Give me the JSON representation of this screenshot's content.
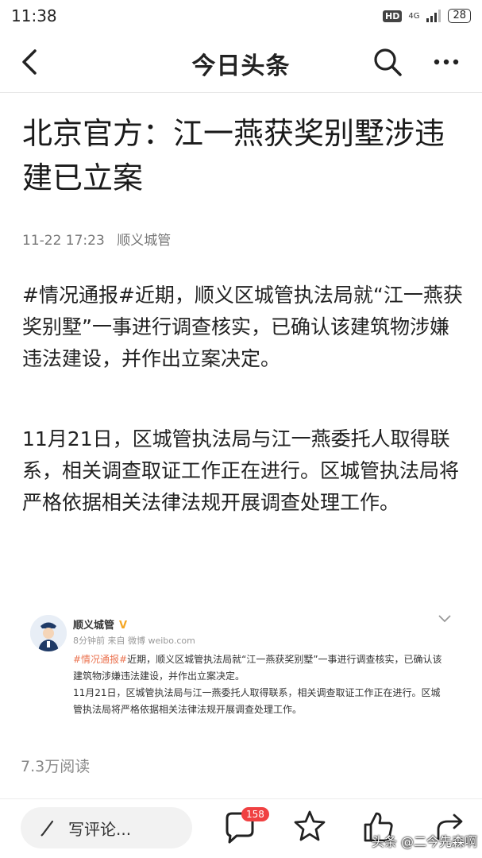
{
  "status": {
    "time": "11:38",
    "network": "4G",
    "hd": "HD",
    "battery": "28"
  },
  "nav": {
    "title": "今日头条"
  },
  "article": {
    "title": "北京官方：江一燕获奖别墅涉违建已立案",
    "date": "11-22 17:23",
    "author": "顺义城管",
    "paragraphs": [
      "#情况通报#近期，顺义区城管执法局就“江一燕获奖别墅”一事进行调查核实，已确认该建筑物涉嫌违法建设，并作出立案决定。",
      "11月21日，区城管执法局与江一燕委托人取得联系，相关调查取证工作正在进行。区城管执法局将严格依据相关法律法规开展调查处理工作。"
    ]
  },
  "embed": {
    "name": "顺义城管",
    "verified_mark": "V",
    "time_source": "8分钟前 来自 微博 weibo.com",
    "tag": "#情况通报#",
    "text_after_tag": "近期，顺义区城管执法局就“江一燕获奖别墅”一事进行调查核实，已确认该建筑物涉嫌违法建设，并作出立案决定。",
    "text2": "11月21日，区城管执法局与江一燕委托人取得联系，相关调查取证工作正在进行。区城管执法局将严格依据相关法律法规开展调查处理工作。",
    "tag_color": "#eb7350"
  },
  "reads": "7.3万阅读",
  "bottom": {
    "comment_placeholder": "写评论...",
    "comment_count": "158"
  },
  "watermark": "头条 @二今先森啊"
}
